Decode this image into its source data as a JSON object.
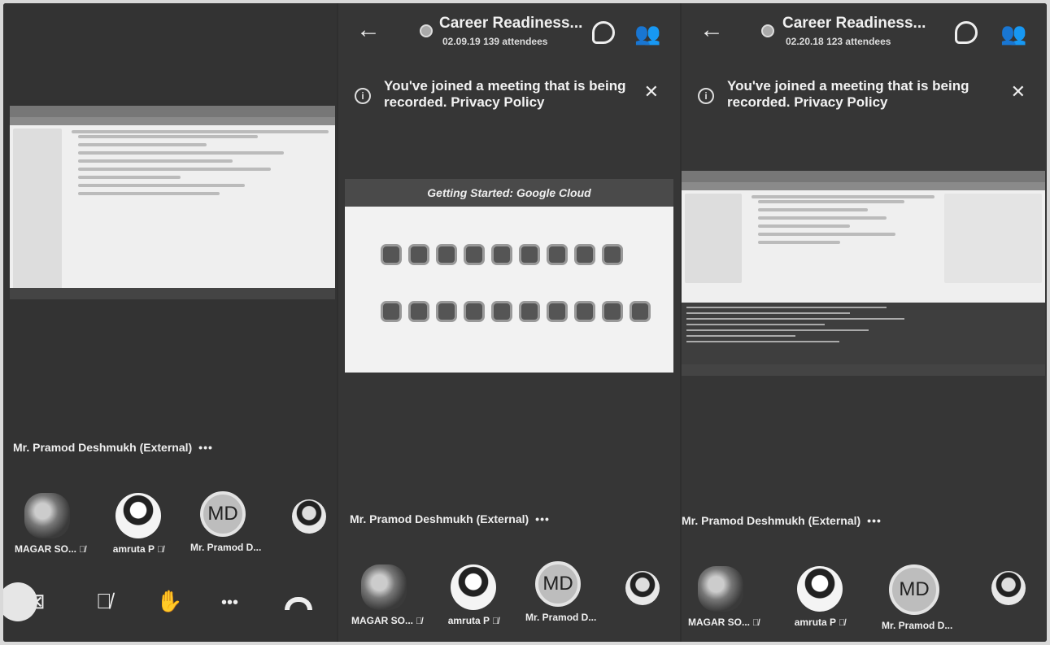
{
  "meeting": {
    "title": "Career Readiness...",
    "panels": [
      {
        "duration": "02.09.19",
        "attendees": "139 attendees"
      },
      {
        "duration": "02.20.18",
        "attendees": "123 attendees"
      }
    ]
  },
  "banner": {
    "text": "You've joined a meeting that is being recorded. Privacy Policy",
    "close_icon": "close-icon"
  },
  "presenter": {
    "name": "Mr. Pramod Deshmukh (External)",
    "more": "•••"
  },
  "slide": {
    "heading": "Getting Started: Google Cloud"
  },
  "participants": [
    {
      "label": "MAGAR SO...",
      "avatar": "flower-photo",
      "muted": true
    },
    {
      "label": "amruta P",
      "avatar": "woman-photo",
      "muted": true
    },
    {
      "label": "Mr. Pramod D...",
      "avatar_initials": "MD",
      "muted": false
    },
    {
      "label": "",
      "avatar": "man-photo",
      "muted": false
    }
  ],
  "controls": {
    "icons": [
      "camera-off-icon",
      "mic-off-icon",
      "raise-hand-icon",
      "more-icon",
      "hangup-icon"
    ],
    "more_label": "•••"
  },
  "colors": {
    "background": "#2f2f2f",
    "text": "#f0f0f0"
  }
}
